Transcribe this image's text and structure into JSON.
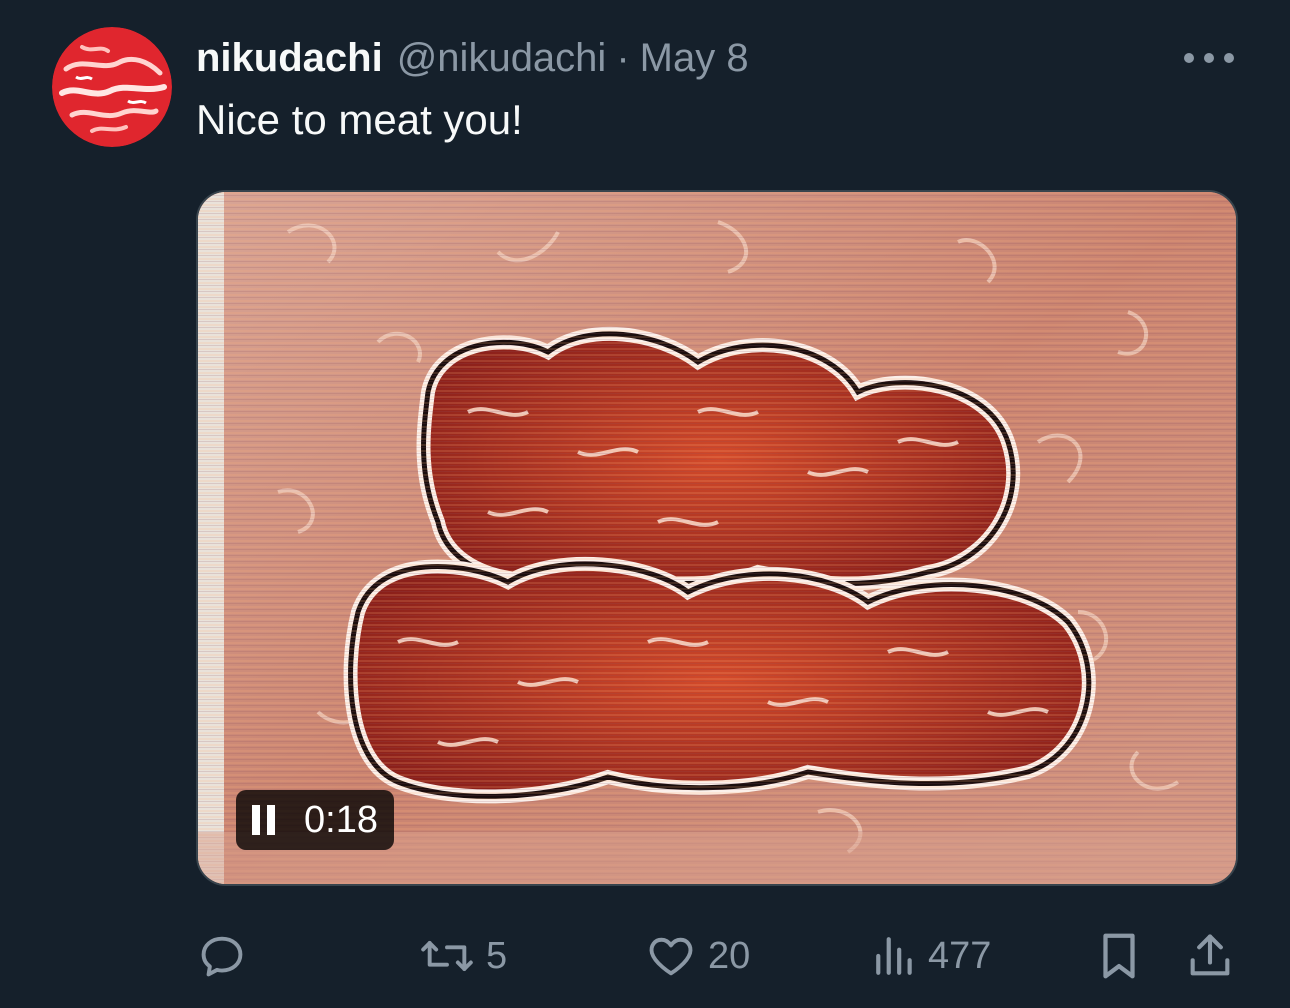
{
  "tweet": {
    "display_name": "nikudachi",
    "handle": "@nikudachi",
    "separator": "·",
    "date": "May 8",
    "text": "Nice to meat you!"
  },
  "media": {
    "type": "video",
    "state": "playing",
    "time": "0:18"
  },
  "actions": {
    "replies": "",
    "retweets": "5",
    "likes": "20",
    "views": "477"
  },
  "colors": {
    "background": "#15202b",
    "primary_text": "#f7f9f9",
    "secondary_text": "#8b98a5",
    "border": "#38444d"
  },
  "icons": {
    "more": "more-dots-icon",
    "reply": "reply-bubble-icon",
    "retweet": "retweet-arrows-icon",
    "like": "heart-icon",
    "views": "bar-chart-icon",
    "bookmark": "bookmark-icon",
    "share": "share-upload-icon",
    "pause": "pause-icon"
  }
}
